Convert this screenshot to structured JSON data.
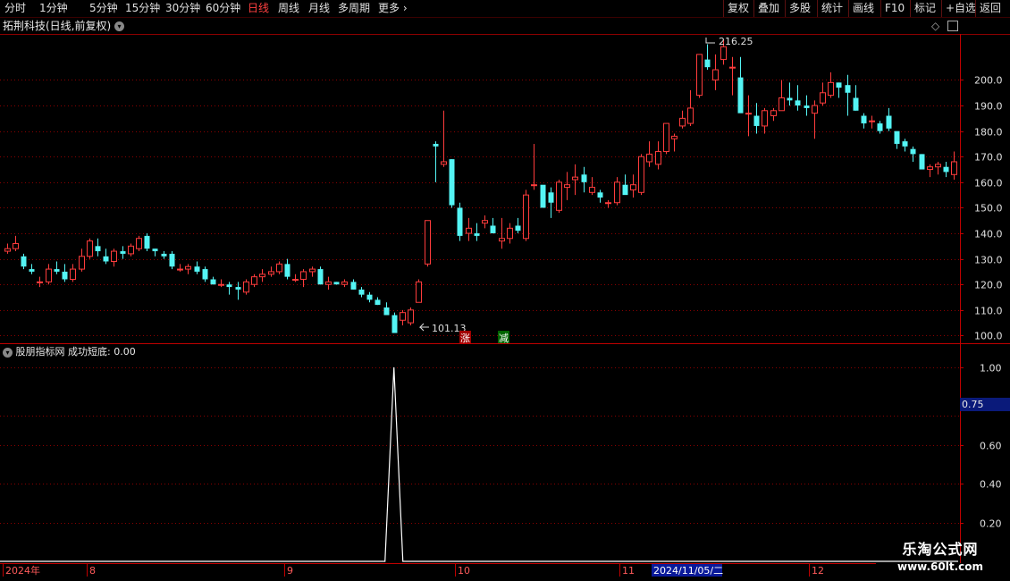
{
  "toolbar": {
    "periods": [
      "分时",
      "1分钟",
      "5分钟",
      "15分钟",
      "30分钟",
      "60分钟",
      "日线",
      "周线",
      "月线",
      "多周期",
      "更多"
    ],
    "active_period": "日线",
    "right_buttons": [
      "复权",
      "叠加",
      "多股",
      "统计",
      "画线",
      "F10",
      "标记",
      "+自选",
      "返回"
    ]
  },
  "stock": {
    "title": "拓荆科技(日线,前复权)",
    "high_label": "216.25",
    "low_label": "101.13",
    "marker_up": "涨",
    "marker_down": "减"
  },
  "indicator": {
    "name": "股朋指标网",
    "formula_label": "成功短底: 0.00",
    "current_value": "0.75"
  },
  "axes": {
    "price_ticks": [
      "200.0",
      "190.0",
      "180.0",
      "170.0",
      "160.0",
      "150.0",
      "140.0",
      "130.0",
      "120.0",
      "110.0",
      "100.0"
    ],
    "indicator_ticks": [
      "1.00",
      "0.60",
      "0.40",
      "0.20"
    ],
    "date_labels": [
      "2024年",
      "8",
      "9",
      "10",
      "11",
      "12"
    ],
    "cursor_date": "2024/11/05/二"
  },
  "colors": {
    "up": "#ff3c3c",
    "down": "#54f4f4",
    "grid": "#8b0000",
    "line": "#ffffff"
  },
  "watermark": {
    "line1": "乐淘公式网",
    "line2": "www.60lt.com"
  },
  "chart_data": {
    "type": "candlestick",
    "ylim": [
      97,
      218
    ],
    "candles": [
      [
        133,
        136,
        132,
        134
      ],
      [
        134,
        139,
        133,
        136
      ],
      [
        131,
        132,
        126,
        127
      ],
      [
        126,
        128,
        124,
        125
      ],
      [
        121,
        123,
        119,
        121
      ],
      [
        121,
        128,
        120,
        126
      ],
      [
        126,
        129,
        124,
        125
      ],
      [
        125,
        128,
        121,
        122
      ],
      [
        122,
        128,
        121,
        126
      ],
      [
        126,
        134,
        125,
        131
      ],
      [
        131,
        138,
        130,
        137
      ],
      [
        135,
        138,
        131,
        133
      ],
      [
        131,
        134,
        128,
        129
      ],
      [
        129,
        134,
        127,
        133
      ],
      [
        133,
        135,
        130,
        132
      ],
      [
        132,
        136,
        131,
        135
      ],
      [
        134,
        139,
        133,
        138
      ],
      [
        139,
        140,
        133,
        134
      ],
      [
        134,
        134,
        131,
        133
      ],
      [
        132,
        133,
        130,
        131
      ],
      [
        132,
        133,
        126,
        127
      ],
      [
        126,
        128,
        125,
        126
      ],
      [
        126,
        128,
        124,
        127
      ],
      [
        127,
        129,
        124,
        125
      ],
      [
        126,
        127,
        121,
        122
      ],
      [
        122,
        123,
        120,
        120
      ],
      [
        120,
        122,
        119,
        120
      ],
      [
        120,
        121,
        116,
        119
      ],
      [
        119,
        121,
        114,
        118
      ],
      [
        117,
        122,
        116,
        121
      ],
      [
        120,
        124,
        119,
        123
      ],
      [
        123,
        126,
        121,
        124
      ],
      [
        124,
        127,
        123,
        125
      ],
      [
        125,
        129,
        124,
        128
      ],
      [
        128,
        130,
        122,
        123
      ],
      [
        122,
        124,
        121,
        122
      ],
      [
        122,
        126,
        119,
        125
      ],
      [
        125,
        127,
        123,
        126
      ],
      [
        126,
        127,
        120,
        120
      ],
      [
        120,
        123,
        118,
        121
      ],
      [
        121,
        121,
        120,
        120
      ],
      [
        120,
        122,
        119,
        121
      ],
      [
        121,
        122,
        118,
        118
      ],
      [
        118,
        119,
        115,
        116
      ],
      [
        116,
        117,
        113,
        114
      ],
      [
        114,
        115,
        112,
        112
      ],
      [
        111,
        113,
        108,
        108
      ],
      [
        108,
        109,
        101,
        101
      ],
      [
        106,
        110,
        104,
        109
      ],
      [
        105,
        111,
        104,
        110
      ],
      [
        113,
        122,
        113,
        121
      ],
      [
        128,
        144,
        127,
        145
      ],
      [
        175,
        176,
        160,
        174
      ],
      [
        167,
        188,
        166,
        168
      ],
      [
        169,
        169,
        150,
        151
      ],
      [
        150,
        152,
        137,
        139
      ],
      [
        140,
        146,
        137,
        142
      ],
      [
        140,
        144,
        137,
        139
      ],
      [
        144,
        147,
        142,
        145
      ],
      [
        143,
        146,
        140,
        140
      ],
      [
        137,
        146,
        134,
        138
      ],
      [
        138,
        144,
        136,
        142
      ],
      [
        143,
        146,
        140,
        141
      ],
      [
        138,
        157,
        137,
        155
      ],
      [
        159,
        175,
        157,
        159
      ],
      [
        159,
        156,
        154,
        150
      ],
      [
        156,
        158,
        146,
        152
      ],
      [
        149,
        161,
        148,
        160
      ],
      [
        158,
        164,
        153,
        159
      ],
      [
        161,
        167,
        155,
        162
      ],
      [
        163,
        166,
        156,
        160
      ],
      [
        156,
        162,
        155,
        158
      ],
      [
        156,
        157,
        152,
        154
      ],
      [
        152,
        153,
        150,
        152
      ],
      [
        152,
        162,
        151,
        160
      ],
      [
        159,
        163,
        158,
        155
      ],
      [
        157,
        163,
        154,
        159
      ],
      [
        156,
        171,
        155,
        170
      ],
      [
        168,
        176,
        166,
        171
      ],
      [
        167,
        176,
        165,
        172
      ],
      [
        172,
        183,
        171,
        183
      ],
      [
        177,
        179,
        172,
        178
      ],
      [
        182,
        188,
        181,
        185
      ],
      [
        183,
        196,
        182,
        189
      ],
      [
        194,
        210,
        193,
        210
      ],
      [
        208,
        214,
        204,
        205
      ],
      [
        200,
        210,
        196,
        204
      ],
      [
        208,
        216,
        206,
        213
      ],
      [
        205,
        209,
        194,
        205
      ],
      [
        201,
        209,
        188,
        187
      ],
      [
        187,
        194,
        178,
        187
      ],
      [
        186,
        191,
        179,
        182
      ],
      [
        182,
        189,
        179,
        188
      ],
      [
        186,
        189,
        184,
        188
      ],
      [
        188,
        200,
        188,
        193
      ],
      [
        193,
        199,
        190,
        192
      ],
      [
        192,
        198,
        188,
        190
      ],
      [
        190,
        194,
        186,
        189
      ],
      [
        187,
        192,
        177,
        190
      ],
      [
        191,
        199,
        190,
        195
      ],
      [
        194,
        203,
        193,
        199
      ],
      [
        199,
        199,
        193,
        197
      ],
      [
        198,
        202,
        186,
        195
      ],
      [
        193,
        198,
        188,
        188
      ],
      [
        186,
        187,
        181,
        183
      ],
      [
        184,
        186,
        181,
        184
      ],
      [
        183,
        184,
        179,
        180
      ],
      [
        186,
        189,
        180,
        181
      ],
      [
        180,
        178,
        173,
        175
      ],
      [
        176,
        177,
        172,
        174
      ],
      [
        173,
        174,
        168,
        171
      ],
      [
        171,
        171,
        166,
        165
      ],
      [
        165,
        167,
        162,
        166
      ],
      [
        166,
        168,
        163,
        167
      ],
      [
        166,
        168,
        162,
        164
      ],
      [
        163,
        172,
        161,
        168
      ]
    ],
    "indicator": {
      "name": "成功短底",
      "values_note": "0 everywhere except a single spike of 1.00",
      "spike_value": 1.0,
      "ylim": [
        0,
        1.05
      ]
    }
  }
}
